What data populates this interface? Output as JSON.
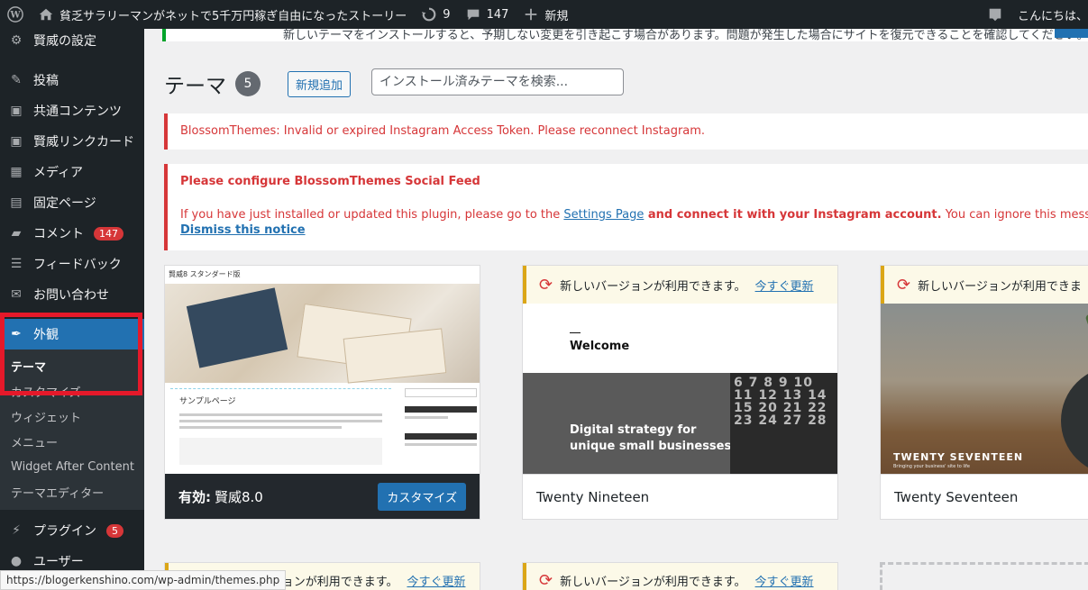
{
  "adminbar": {
    "site_name": "貧乏サラリーマンがネットで5千万円稼ぎ自由になったストーリー",
    "updates_count": "9",
    "comments_count": "147",
    "new_label": "新規",
    "greeting": "こんにちは、"
  },
  "sidebar": {
    "items": [
      {
        "label": "賢威の設定",
        "icon": "gear-icon"
      },
      {
        "label": "投稿",
        "icon": "pin-icon"
      },
      {
        "label": "共通コンテンツ",
        "icon": "code-icon"
      },
      {
        "label": "賢威リンクカード",
        "icon": "code-icon"
      },
      {
        "label": "メディア",
        "icon": "media-icon"
      },
      {
        "label": "固定ページ",
        "icon": "page-icon"
      },
      {
        "label": "コメント",
        "icon": "comment-icon",
        "badge": "147"
      },
      {
        "label": "フィードバック",
        "icon": "feedback-icon"
      },
      {
        "label": "お問い合わせ",
        "icon": "mail-icon"
      },
      {
        "label": "外観",
        "icon": "brush-icon"
      },
      {
        "label": "プラグイン",
        "icon": "plugin-icon",
        "badge": "5"
      },
      {
        "label": "ユーザー",
        "icon": "user-icon"
      }
    ],
    "submenu": [
      "テーマ",
      "カスタマイズ",
      "ウィジェット",
      "メニュー",
      "Widget After Content",
      "テーマエディター"
    ]
  },
  "top_notice": "新しいテーマをインストールすると、予期しない変更を引き起こす場合があります。問題が発生した場合にサイトを復元できることを確認してください。",
  "page": {
    "title": "テーマ",
    "count": "5",
    "add_new": "新規追加",
    "search_placeholder": "インストール済みテーマを検索..."
  },
  "notices": {
    "n1": "BlossomThemes: Invalid or expired Instagram Access Token. Please reconnect Instagram.",
    "n2_title": "Please configure BlossomThemes Social Feed",
    "n2_text_a": "If you have just installed or updated this plugin, please go to the ",
    "n2_link": "Settings Page",
    "n2_text_b": " and connect it with your Instagram account.",
    "n2_text_c": " You can ignore this message if you have already co",
    "dismiss": "Dismiss this notice"
  },
  "themes": {
    "active_label": "有効:",
    "active_name": "賢威8.0",
    "customize": "カスタマイズ",
    "update_text": "新しいバージョンが利用できます。",
    "update_link": "今すぐ更新",
    "update_text_cut": "新しいバージョンが利用できま",
    "update_text_bottom": "ージョンが利用できます。",
    "cards": [
      {
        "name": "Twenty Nineteen"
      },
      {
        "name": "Twenty Seventeen"
      }
    ],
    "shot1_title": "賢威8 スタンダード版",
    "shot1_heading": "サンプルページ",
    "shot2_welcome": "Welcome",
    "shot2_tagline_1": "Digital strategy for",
    "shot2_tagline_2": "unique small businesses",
    "shot2_calendar": "6 7 8 9 10 11 12 13 14 15 20 21 22 23 24 27 28",
    "shot3_title": "TWENTY SEVENTEEN",
    "shot3_sub": "Bringing your business' site to life"
  },
  "statusbar": "https://blogerkenshino.com/wp-admin/themes.php",
  "colors": {
    "accent": "#2271b1",
    "error": "#d63638",
    "highlight": "#e5192a"
  }
}
